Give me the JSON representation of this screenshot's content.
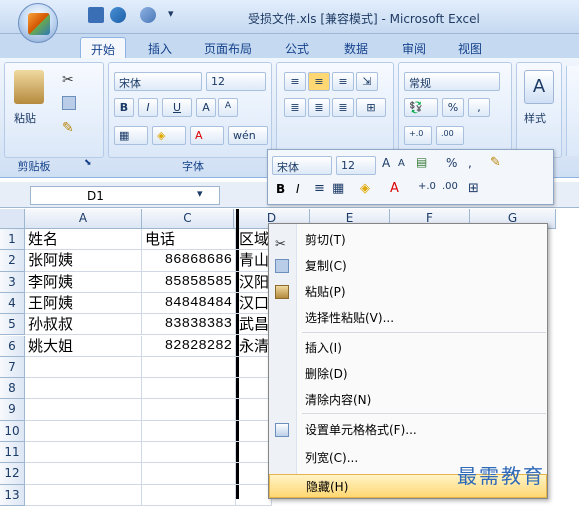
{
  "window": {
    "title": "受损文件.xls [兼容模式] - Microsoft Excel"
  },
  "tabs": [
    "开始",
    "插入",
    "页面布局",
    "公式",
    "数据",
    "审阅",
    "视图"
  ],
  "ribbon": {
    "clipboard": {
      "label": "剪贴板",
      "paste": "粘贴"
    },
    "font": {
      "label": "字体",
      "name": "宋体",
      "size": "12",
      "bold": "B",
      "italic": "I",
      "underline": "U",
      "grow": "A",
      "shrink": "A",
      "wen": "wén"
    },
    "number": {
      "format": "常规",
      "percent": "%",
      "comma": ",",
      "inc": "+.0",
      "dec": ".00"
    },
    "styles": {
      "label": "样式"
    }
  },
  "mini_toolbar": {
    "font": "宋体",
    "size": "12",
    "bold": "B",
    "italic": "I",
    "percent": "%",
    "comma": ","
  },
  "formula_bar": {
    "name_box": "D1"
  },
  "columns": [
    "A",
    "C",
    "D",
    "E",
    "F",
    "G"
  ],
  "rows": [
    "1",
    "2",
    "3",
    "4",
    "5",
    "6",
    "7",
    "8",
    "9",
    "10",
    "11",
    "12",
    "13"
  ],
  "table": [
    {
      "name": "姓名",
      "phone": "电话",
      "area": "区域"
    },
    {
      "name": "张阿姨",
      "phone": "86868686",
      "area": "青山"
    },
    {
      "name": "李阿姨",
      "phone": "85858585",
      "area": "汉阳"
    },
    {
      "name": "王阿姨",
      "phone": "84848484",
      "area": "汉口"
    },
    {
      "name": "孙叔叔",
      "phone": "83838383",
      "area": "武昌"
    },
    {
      "name": "姚大姐",
      "phone": "82828282",
      "area": "永清"
    }
  ],
  "context_menu": [
    {
      "label": "剪切(T)",
      "icon": "scissors-icon"
    },
    {
      "label": "复制(C)",
      "icon": "copy-icon"
    },
    {
      "label": "粘贴(P)",
      "icon": "paste-icon"
    },
    {
      "label": "选择性粘贴(V)...",
      "icon": ""
    },
    {
      "label": "插入(I)",
      "icon": ""
    },
    {
      "label": "删除(D)",
      "icon": ""
    },
    {
      "label": "清除内容(N)",
      "icon": ""
    },
    {
      "label": "设置单元格格式(F)...",
      "icon": "format-cells-icon"
    },
    {
      "label": "列宽(C)...",
      "icon": ""
    },
    {
      "label": "隐藏(H)",
      "icon": ""
    }
  ],
  "watermark": "最需教育",
  "colors": {
    "ribbon": "#dbe7f7",
    "highlight": "#ffd873",
    "accent": "#15428b"
  }
}
